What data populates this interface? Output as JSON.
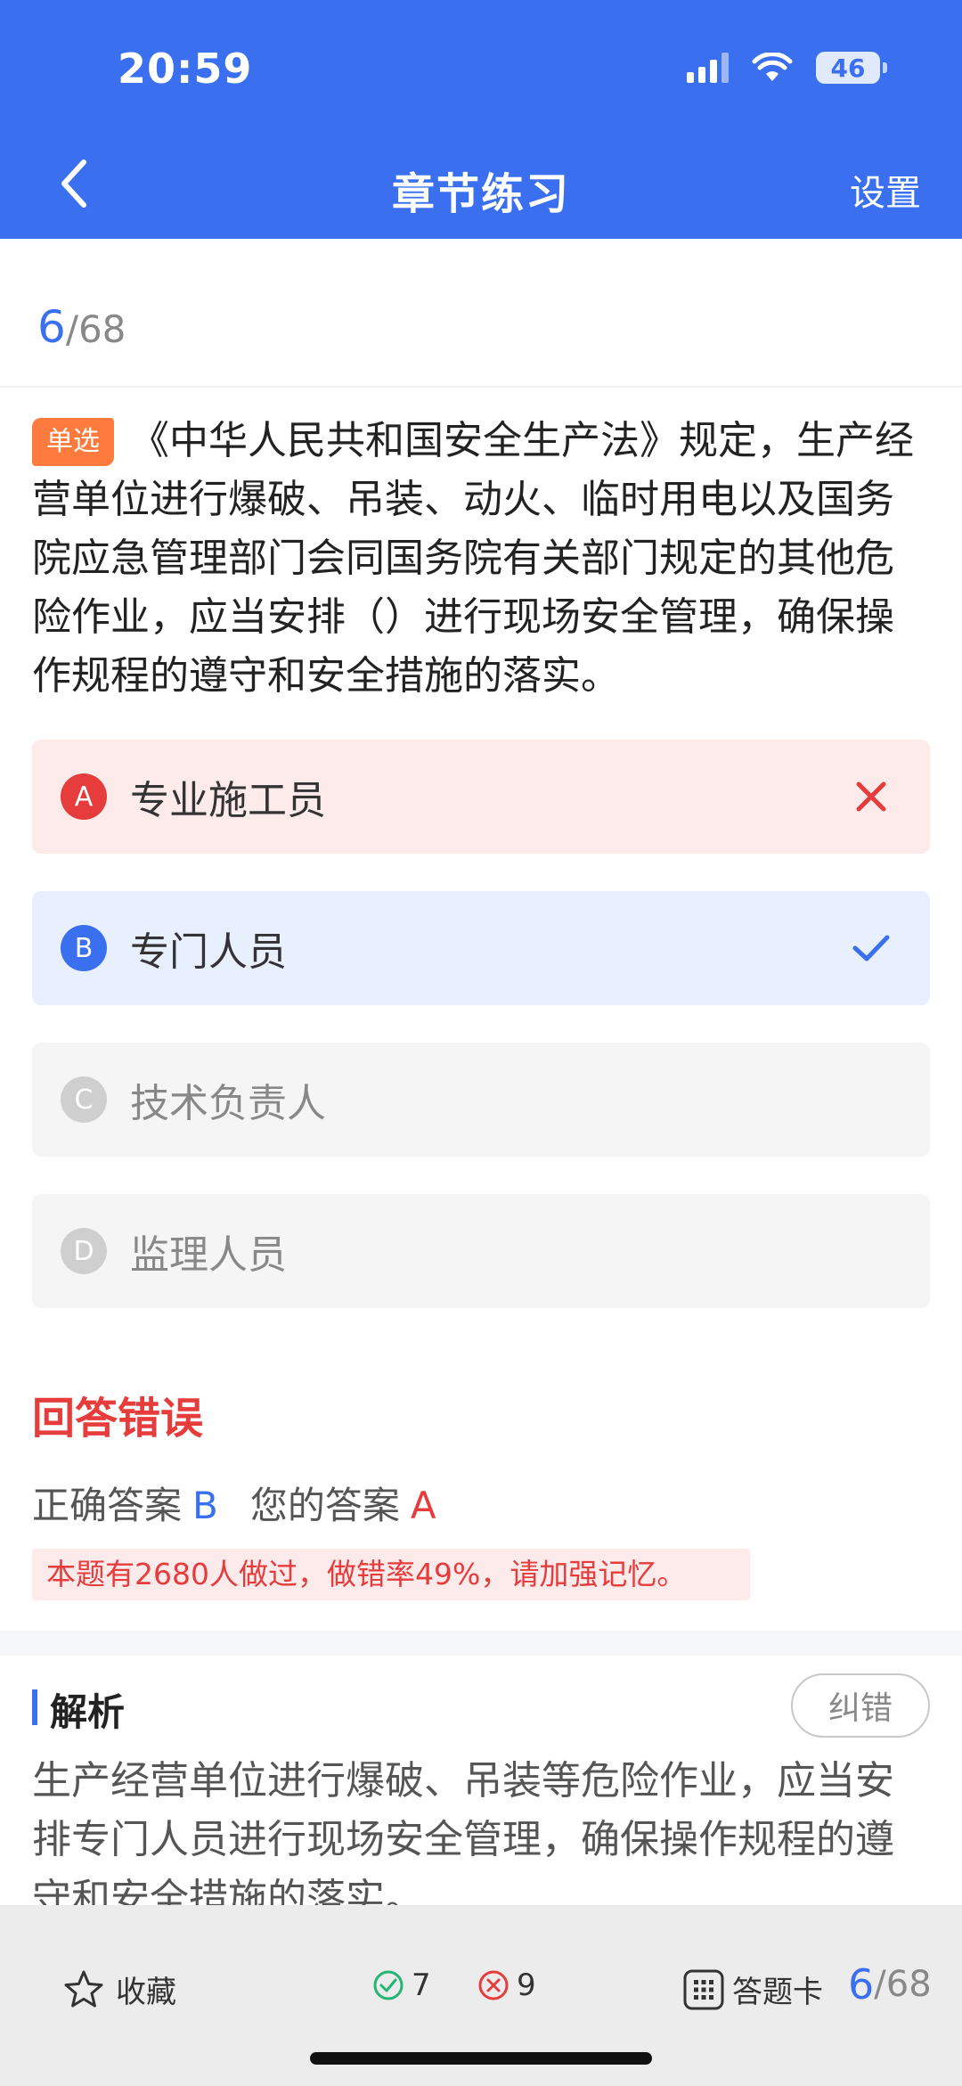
{
  "status": {
    "time": "20:59",
    "battery": "46"
  },
  "nav": {
    "title": "章节练习",
    "settings": "设置"
  },
  "progress": {
    "current": "6",
    "total": "/68"
  },
  "question": {
    "type": "单选",
    "text": "《中华人民共和国安全生产法》规定，生产经营单位进行爆破、吊装、动火、临时用电以及国务院应急管理部门会同国务院有关部门规定的其他危险作业，应当安排（）进行现场安全管理，确保操作规程的遵守和安全措施的落实。"
  },
  "options": [
    {
      "letter": "A",
      "text": "专业施工员",
      "state": "wrong"
    },
    {
      "letter": "B",
      "text": "专门人员",
      "state": "correct"
    },
    {
      "letter": "C",
      "text": "技术负责人",
      "state": "none"
    },
    {
      "letter": "D",
      "text": "监理人员",
      "state": "none"
    }
  ],
  "result": {
    "title": "回答错误",
    "correct_label": "正确答案",
    "correct_value": "B",
    "your_label": "您的答案",
    "your_value": "A",
    "stat_tip": "本题有2680人做过，做错率49%，请加强记忆。"
  },
  "analysis": {
    "title": "解析",
    "feedback_button": "纠错",
    "text": "生产经营单位进行爆破、吊装等危险作业，应当安排专门人员进行现场安全管理，确保操作规程的遵守和安全措施的落实。"
  },
  "bottom_bar": {
    "favorite_label": "收藏",
    "right_count": "7",
    "wrong_count": "9",
    "answer_card_label": "答题卡",
    "progress_current": "6",
    "progress_total": "/68"
  },
  "colors": {
    "primary": "#3a6ff0",
    "error": "#e63c3c",
    "badge": "#ff7a3d",
    "success": "#22b573"
  }
}
